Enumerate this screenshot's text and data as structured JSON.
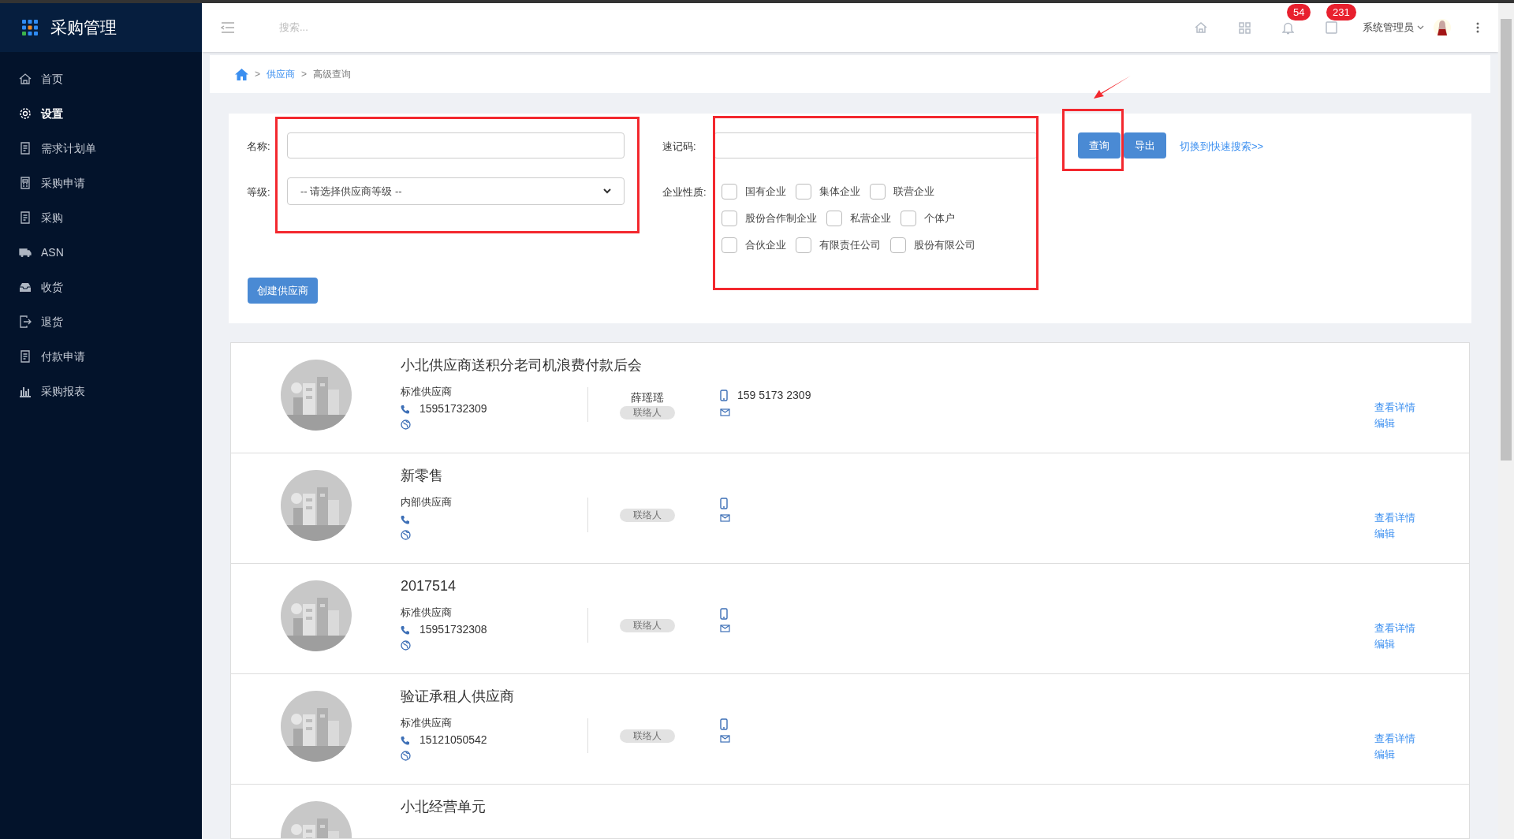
{
  "sidebar": {
    "title": "采购管理",
    "items": [
      {
        "label": "首页",
        "selected": false
      },
      {
        "label": "设置",
        "selected": true
      },
      {
        "label": "需求计划单",
        "selected": false
      },
      {
        "label": "采购申请",
        "selected": false
      },
      {
        "label": "采购",
        "selected": false
      },
      {
        "label": "ASN",
        "selected": false
      },
      {
        "label": "收货",
        "selected": false
      },
      {
        "label": "退货",
        "selected": false
      },
      {
        "label": "付款申请",
        "selected": false
      },
      {
        "label": "采购报表",
        "selected": false
      }
    ]
  },
  "topbar": {
    "search_placeholder": "搜索...",
    "notifications": "54",
    "messages": "231",
    "user": "系统管理员"
  },
  "breadcrumb": {
    "separator_1": ">",
    "link": "供应商",
    "separator_2": ">",
    "current": "高级查询"
  },
  "filter": {
    "name_label": "名称:",
    "level_label": "等级:",
    "level_placeholder": "-- 请选择供应商等级 --",
    "code_label": "速记码:",
    "nature_label": "企业性质:",
    "natures": [
      [
        {
          "label": "国有企业",
          "checked": false
        },
        {
          "label": "集体企业",
          "checked": false
        },
        {
          "label": "联营企业",
          "checked": false
        }
      ],
      [
        {
          "label": "股份合作制企业",
          "checked": false
        },
        {
          "label": "私营企业",
          "checked": false
        },
        {
          "label": "个体户",
          "checked": false
        }
      ],
      [
        {
          "label": "合伙企业",
          "checked": false
        },
        {
          "label": "有限责任公司",
          "checked": false
        },
        {
          "label": "股份有限公司",
          "checked": false
        }
      ]
    ],
    "query_button": "查询",
    "export_button": "导出",
    "switch_link": "切换到快速搜索>>",
    "create_button": "创建供应商"
  },
  "suppliers": [
    {
      "name": "小北供应商送积分老司机浪费付款后会",
      "type": "标准供应商",
      "phone": "15951732309",
      "contact_name": "薛瑶瑶",
      "contact_badge": "联络人",
      "mobile": "159 5173 2309",
      "view": "查看详情",
      "edit": "编辑"
    },
    {
      "name": "新零售",
      "type": "内部供应商",
      "contact_badge": "联络人",
      "view": "查看详情",
      "edit": "编辑"
    },
    {
      "name": "2017514",
      "type": "标准供应商",
      "phone": "15951732308",
      "contact_badge": "联络人",
      "view": "查看详情",
      "edit": "编辑"
    },
    {
      "name": "验证承租人供应商",
      "type": "标准供应商",
      "phone": "15121050542",
      "contact_badge": "联络人",
      "view": "查看详情",
      "edit": "编辑"
    },
    {
      "name": "小北经营单元"
    }
  ]
}
